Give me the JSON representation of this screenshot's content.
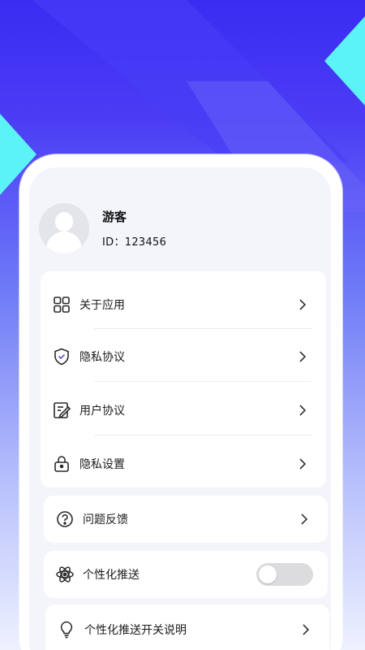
{
  "profile": {
    "name": "游客",
    "id_text": "ID：123456"
  },
  "menu_group_1": [
    {
      "label": "关于应用",
      "icon": "grid-apps-icon"
    },
    {
      "label": "隐私协议",
      "icon": "shield-check-icon"
    },
    {
      "label": "用户协议",
      "icon": "document-pen-icon"
    },
    {
      "label": "隐私设置",
      "icon": "lock-icon"
    }
  ],
  "menu_feedback": {
    "label": "问题反馈",
    "icon": "question-circle-icon"
  },
  "menu_push": {
    "label": "个性化推送",
    "icon": "atom-icon",
    "toggle_on": false
  },
  "menu_push_info": {
    "label": "个性化推送开关说明",
    "icon": "lightbulb-icon"
  },
  "colors": {
    "accent": "#3a2cf2",
    "cyan": "#5cf3f6",
    "toggle_off": "#dcdcdf"
  }
}
